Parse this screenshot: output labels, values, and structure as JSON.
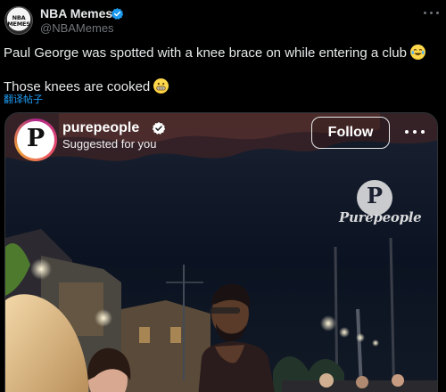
{
  "post": {
    "author_name": "NBA Memes",
    "author_handle": "@NBAMemes",
    "avatar_text": "NBA MEMES",
    "line1": "Paul George was spotted with a knee brace on while entering a club",
    "line2": "Those knees are cooked",
    "translate_label": "翻译帖子"
  },
  "media": {
    "account_name": "purepeople",
    "avatar_letter": "P",
    "suggested_text": "Suggested for you",
    "follow_label": "Follow",
    "watermark_letter": "P",
    "watermark_text": "Purepeople"
  },
  "icons": {
    "verified": "verified-badge-icon",
    "more": "more-options-icon",
    "emoji1": "laughing-tears-emoji-icon",
    "emoji2": "grimacing-emoji-icon"
  },
  "colors": {
    "background": "#000000",
    "text": "#e7e9ea",
    "secondary_text": "#71767b",
    "link": "#1d9bf0",
    "verified": "#1d9bf0"
  }
}
